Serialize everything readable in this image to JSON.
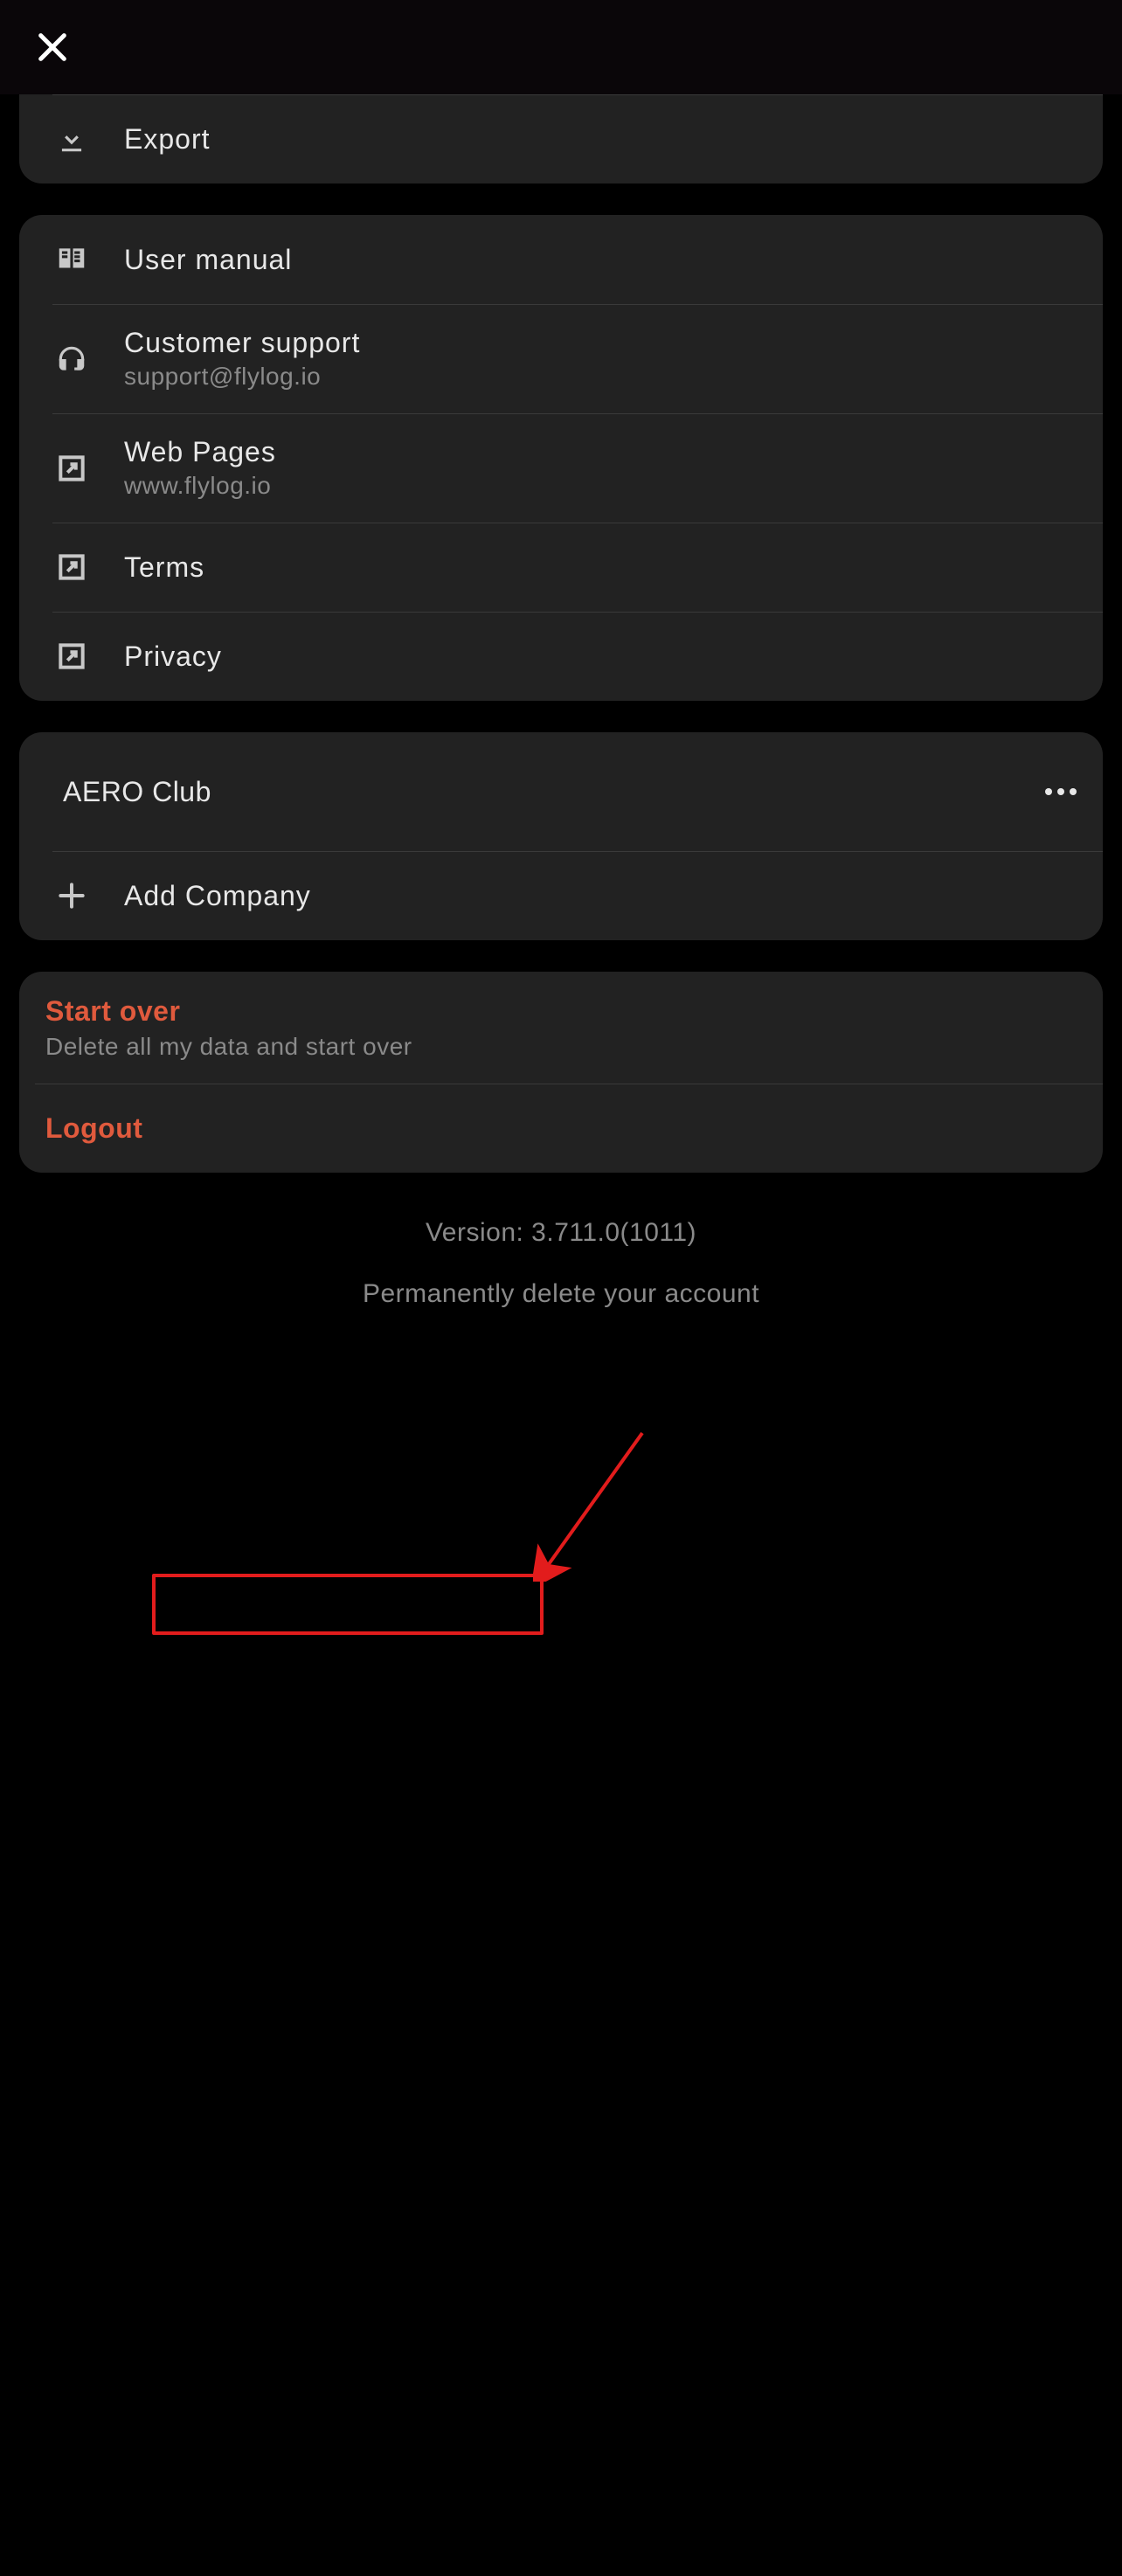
{
  "header": {},
  "groups": {
    "export": {
      "label": "Export"
    },
    "support": {
      "user_manual": "User manual",
      "customer_support": {
        "label": "Customer support",
        "sub": "support@flylog.io"
      },
      "web_pages": {
        "label": "Web Pages",
        "sub": "www.flylog.io"
      },
      "terms": "Terms",
      "privacy": "Privacy"
    },
    "company": {
      "club": "AERO Club",
      "add": "Add Company"
    },
    "danger": {
      "start_over": {
        "label": "Start over",
        "sub": "Delete all my data and start over"
      },
      "logout": "Logout"
    }
  },
  "footer": {
    "version": "Version: 3.711.0(1011)",
    "delete_account": "Permanently delete your account"
  }
}
